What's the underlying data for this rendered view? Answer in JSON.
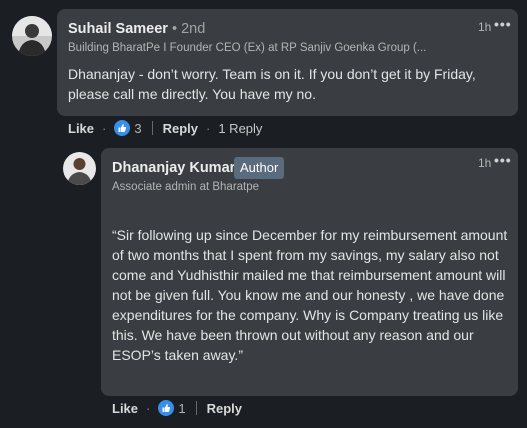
{
  "comment": {
    "author": "Suhail Sameer",
    "degree": "2nd",
    "headline": "Building BharatPe I Founder CEO (Ex) at RP Sanjiv Goenka Group (...",
    "time": "1h",
    "more_icon": "ellipsis-icon",
    "text": "Dhananjay - don’t worry. Team is on it. If you don’t get it by Friday, please call me directly. You have my no.",
    "like_label": "Like",
    "reaction_icon": "thumbs-up-icon",
    "reaction_count": "3",
    "reply_label": "Reply",
    "replies_label": "1 Reply"
  },
  "reply": {
    "author": "Dhananjay Kumar",
    "badge": "Author",
    "headline": "Associate admin at Bharatpe",
    "time": "1h",
    "more_icon": "ellipsis-icon",
    "text": "“Sir following up since December for my reimbursement amount of two months that I spent from my savings, my salary also not come and Yudhisthir mailed me that reimbursement amount will not be given full. You know me and our honesty , we have done expenditures for the company. Why is Company treating us like this. We have been thrown out without any reason and our ESOP’s taken away.”",
    "like_label": "Like",
    "reaction_icon": "thumbs-up-icon",
    "reaction_count": "1",
    "reply_label": "Reply"
  },
  "colors": {
    "background": "#1b1f23",
    "bubble": "#3a3e42",
    "badge": "#5a6b7d",
    "reaction": "#378fe9"
  }
}
